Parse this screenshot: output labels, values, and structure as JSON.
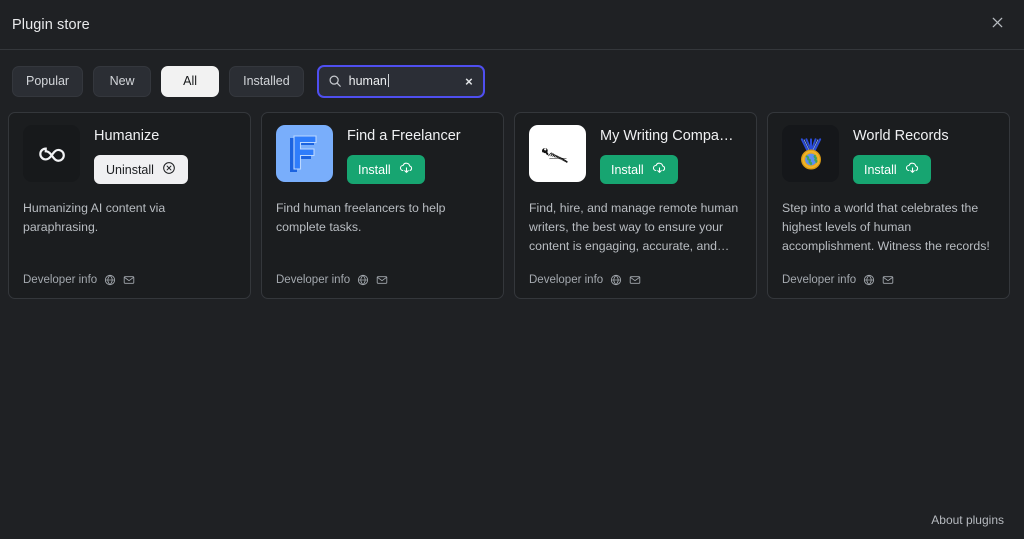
{
  "window": {
    "title": "Plugin store",
    "close_icon": "close-icon",
    "background": "#1f2124",
    "accent_focus": "#4f4ff0",
    "accent_install": "#17a571"
  },
  "toolbar": {
    "filters": [
      {
        "label": "Popular",
        "active": false
      },
      {
        "label": "New",
        "active": false
      },
      {
        "label": "All",
        "active": true
      },
      {
        "label": "Installed",
        "active": false
      }
    ],
    "search": {
      "value": "human",
      "placeholder": "Search",
      "search_icon": "search-icon",
      "clear_icon": "clear-icon",
      "clear_label": "×",
      "focused": true
    }
  },
  "plugins": [
    {
      "title": "Humanize",
      "description": "Humanizing AI content via paraphrasing.",
      "action_label": "Uninstall",
      "action_type": "uninstall",
      "action_icon": "circle-x-icon",
      "icon_name": "infinity-icon",
      "icon_style": "ic-dark",
      "developer_label": "Developer info",
      "developer_icons": [
        "globe-icon",
        "mail-icon"
      ]
    },
    {
      "title": "Find a Freelancer",
      "description": "Find human freelancers to help complete tasks.",
      "action_label": "Install",
      "action_type": "install",
      "action_icon": "cloud-download-icon",
      "icon_name": "letter-f-logo-icon",
      "icon_style": "ic-blue",
      "developer_label": "Developer info",
      "developer_icons": [
        "globe-icon",
        "mail-icon"
      ]
    },
    {
      "title": "My Writing Compa…",
      "description": "Find, hire, and manage remote human writers, the best way to ensure your content is engaging, accurate, and…",
      "action_label": "Install",
      "action_type": "install",
      "action_icon": "cloud-download-icon",
      "icon_name": "find-writers-online-logo-icon",
      "icon_style": "ic-white",
      "developer_label": "Developer info",
      "developer_icons": [
        "globe-icon",
        "mail-icon"
      ]
    },
    {
      "title": "World Records",
      "description": "Step into a world that celebrates the highest levels of human accomplishment. Witness the records!",
      "action_label": "Install",
      "action_type": "install",
      "action_icon": "cloud-download-icon",
      "icon_name": "medal-globe-icon",
      "icon_style": "ic-black",
      "developer_label": "Developer info",
      "developer_icons": [
        "globe-icon",
        "mail-icon"
      ]
    }
  ],
  "footer": {
    "about_label": "About plugins"
  }
}
